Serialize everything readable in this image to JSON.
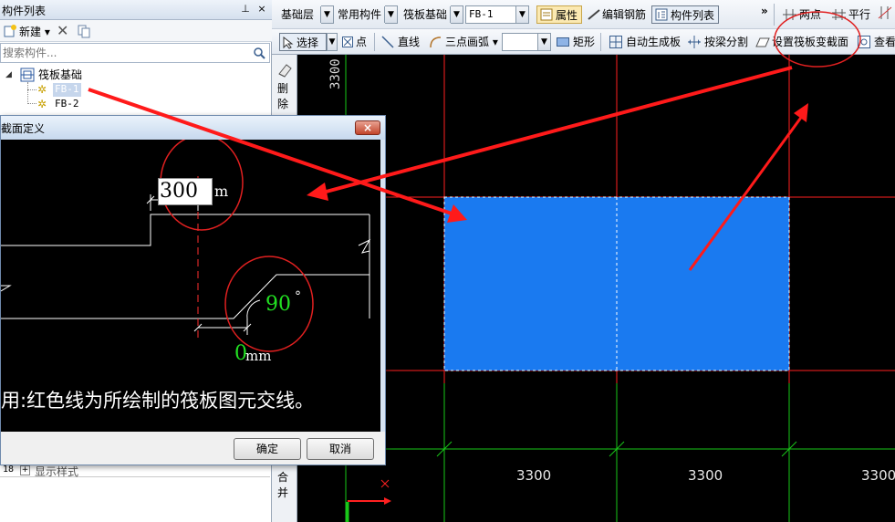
{
  "left_panel": {
    "title": "构件列表",
    "pin_glyph": "⊥",
    "close_glyph": "×",
    "new_label": "新建",
    "search_placeholder": "搜索构件...",
    "tree": {
      "root_label": "筏板基础",
      "items": [
        "FB-1",
        "FB-2"
      ]
    },
    "bottom_row_num": "18",
    "bottom_row_label": "显示样式"
  },
  "vstrip": {
    "delete_label_1": "删",
    "delete_label_2": "除",
    "merge_label_1": "合",
    "merge_label_2": "并"
  },
  "toolbar1": {
    "layer_combo": "基础层",
    "type_combo": "常用构件",
    "category_combo": "筏板基础",
    "component_combo": "FB-1",
    "properties_label": "属性",
    "edit_rebar_label": "编辑钢筋",
    "component_list_label": "构件列表",
    "more_glyph": "»",
    "two_point_label": "两点",
    "parallel_label": "平行"
  },
  "toolbar2": {
    "select_label": "选择",
    "point_label": "点",
    "line_label": "直线",
    "arc_label": "三点画弧",
    "rect_label": "矩形",
    "auto_gen_label": "自动生成板",
    "split_by_beam_label": "按梁分割",
    "set_section_label": "设置筏板变截面",
    "view_label": "查看"
  },
  "canvas": {
    "dim_left_vertical": "3300",
    "dim_bottom_1": "3300",
    "dim_bottom_2": "3300",
    "dim_bottom_3": "3300",
    "colors": {
      "slab_fill": "#1a7af0",
      "grid_red": "#ff2020",
      "grid_green": "#19c819",
      "axis_arrow": "#ff2020"
    }
  },
  "dialog": {
    "title": "截面定义",
    "close_glyph": "×",
    "value_300": "300",
    "unit_m": "m",
    "angle_value": "90",
    "degree_mark": "°",
    "offset_value": "0",
    "offset_unit": "mm",
    "note": "用:红色线为所绘制的筏板图元交线。",
    "ok_label": "确定",
    "cancel_label": "取消"
  },
  "annotations": {
    "arrow_color": "#ff1a1a"
  }
}
